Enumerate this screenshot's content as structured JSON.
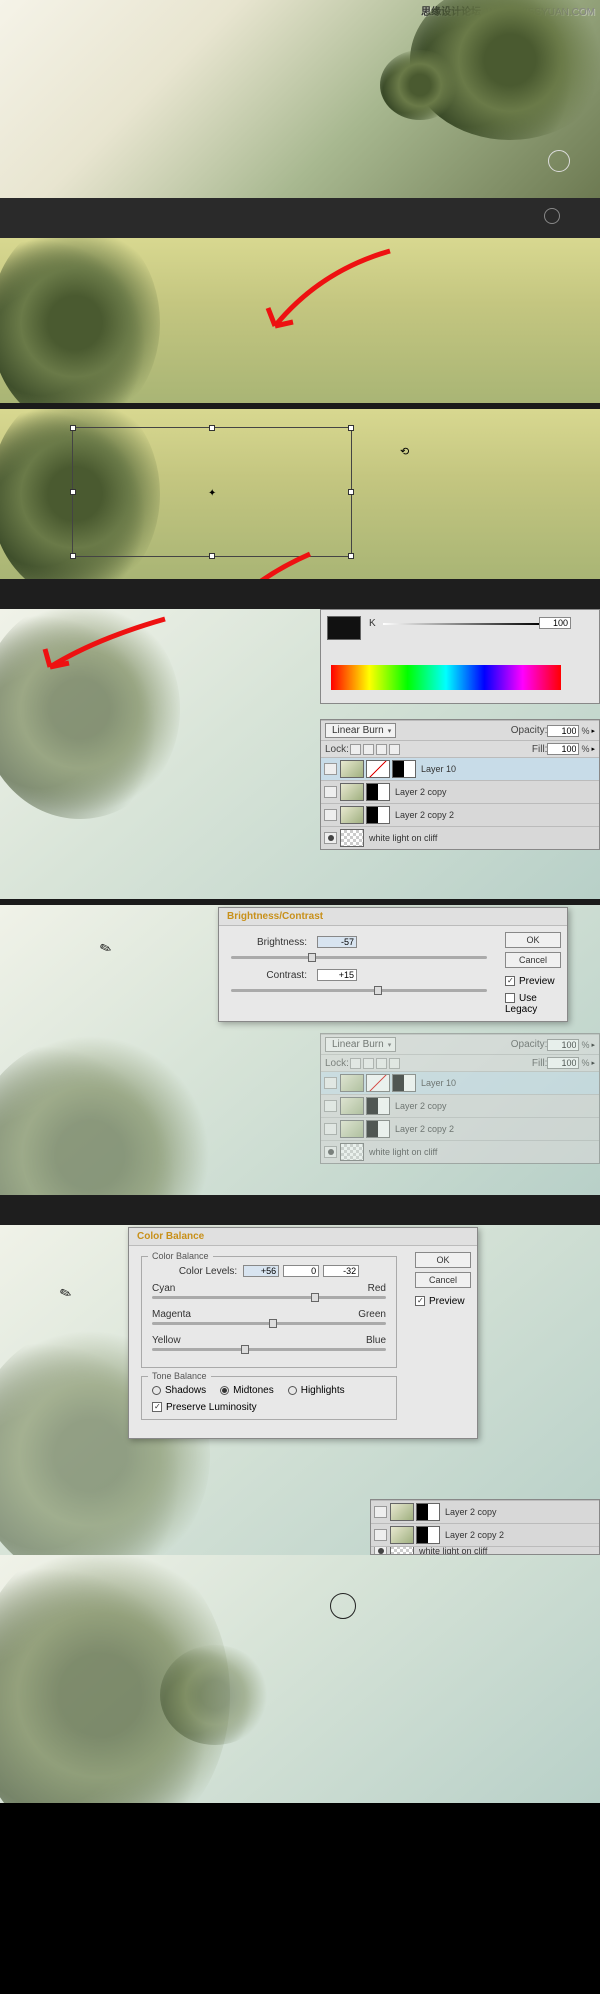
{
  "watermark": {
    "main": "思缘设计论坛",
    "sub": "WWW.MISSYUAN.COM"
  },
  "colorpanel": {
    "k_label": "K",
    "k_value": "100"
  },
  "layers_panel": {
    "blend": "Linear Burn",
    "opacity_label": "Opacity:",
    "opacity_value": "100",
    "lock_label": "Lock:",
    "fill_label": "Fill:",
    "fill_value": "100",
    "rows": [
      {
        "name": "Layer 10"
      },
      {
        "name": "Layer 2 copy"
      },
      {
        "name": "Layer 2 copy 2"
      },
      {
        "name": "white light on cliff"
      }
    ]
  },
  "brightness": {
    "title": "Brightness/Contrast",
    "b_label": "Brightness:",
    "b_value": "-57",
    "c_label": "Contrast:",
    "c_value": "+15",
    "ok": "OK",
    "cancel": "Cancel",
    "preview": "Preview",
    "legacy": "Use Legacy"
  },
  "panel2": {
    "blend": "Linear Burn",
    "opacity_label": "Opacity:",
    "opacity_value": "100",
    "lock_label": "Lock:",
    "fill_label": "Fill:",
    "fill_value": "100",
    "rows": [
      {
        "name": "Layer 10"
      },
      {
        "name": "Layer 2 copy"
      },
      {
        "name": "Layer 2 copy 2"
      },
      {
        "name": "white light on cliff"
      }
    ]
  },
  "colorbal": {
    "title": "Color Balance",
    "group1": "Color Balance",
    "levels_label": "Color Levels:",
    "v1": "+56",
    "v2": "0",
    "v3": "-32",
    "cyan": "Cyan",
    "red": "Red",
    "magenta": "Magenta",
    "green": "Green",
    "yellow": "Yellow",
    "blue": "Blue",
    "group2": "Tone Balance",
    "shadows": "Shadows",
    "midtones": "Midtones",
    "highlights": "Highlights",
    "preserve": "Preserve Luminosity",
    "ok": "OK",
    "cancel": "Cancel",
    "preview": "Preview"
  },
  "bottom_layers": [
    {
      "name": "Layer 2 copy"
    },
    {
      "name": "Layer 2 copy 2"
    },
    {
      "name": "white light on cliff"
    }
  ]
}
